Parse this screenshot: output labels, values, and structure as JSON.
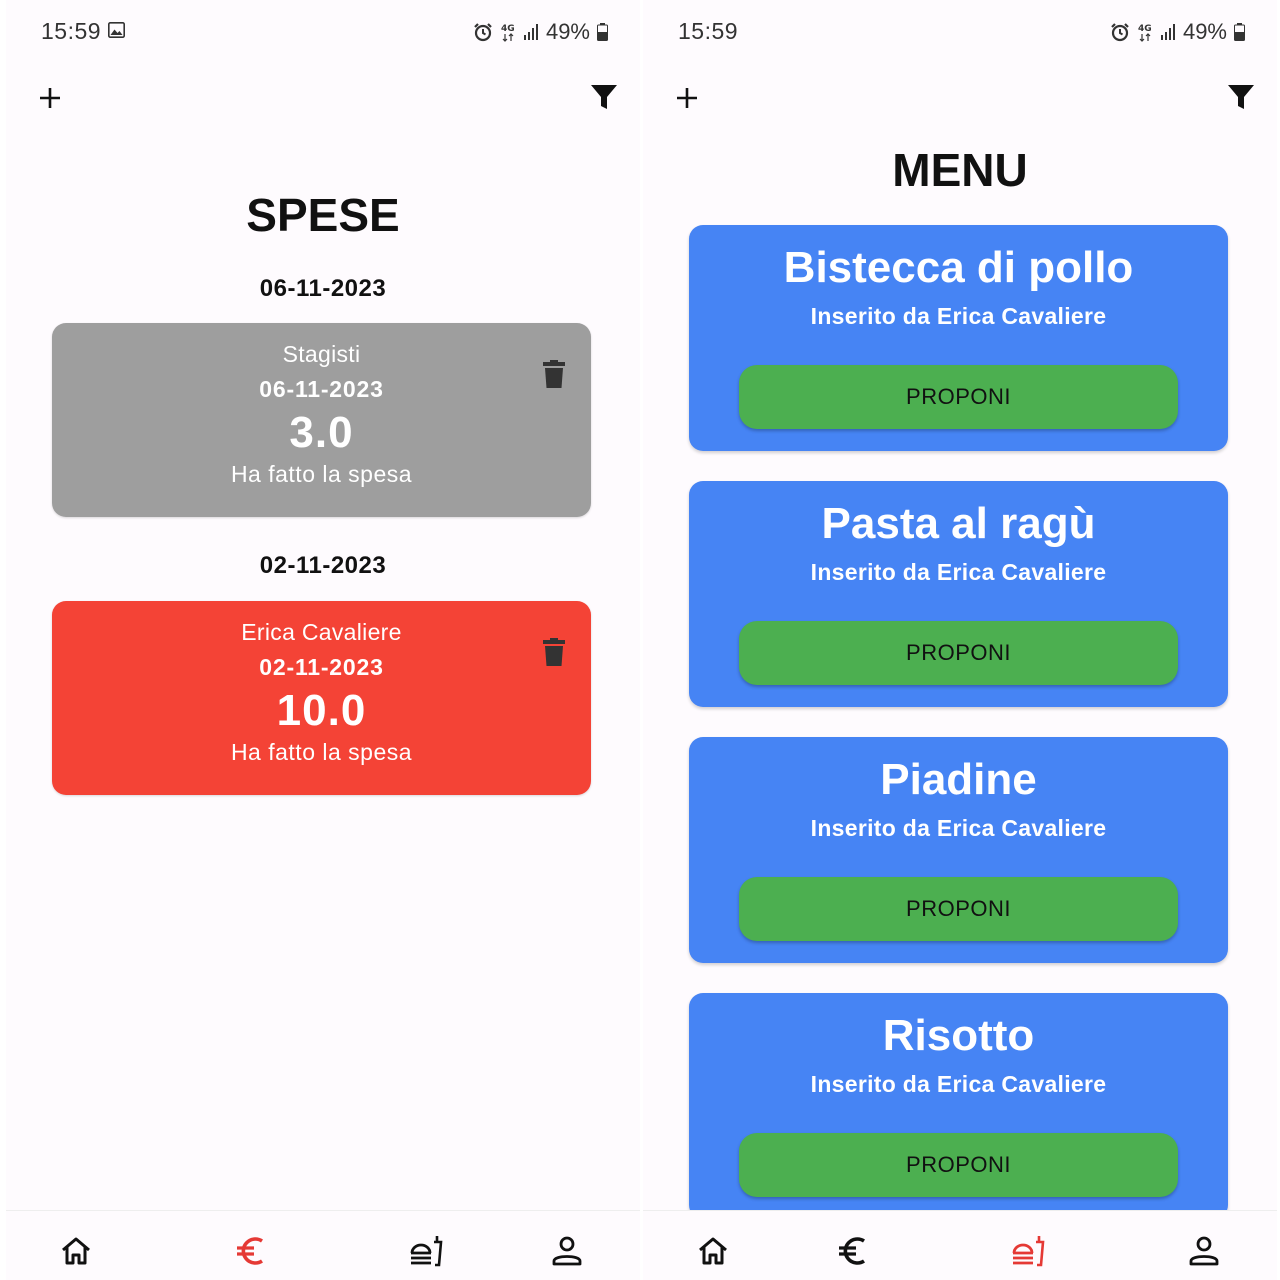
{
  "status_bar": {
    "time": "15:59",
    "battery": "49%",
    "network": "4G",
    "icons": [
      "image-icon",
      "alarm-icon",
      "signal-icon",
      "battery-icon"
    ]
  },
  "left_screen": {
    "title": "SPESE",
    "groups": [
      {
        "date": "06-11-2023",
        "card": {
          "name": "Stagisti",
          "date": "06-11-2023",
          "amount": "3.0",
          "description": "Ha fatto la spesa",
          "color": "#9e9e9e"
        }
      },
      {
        "date": "02-11-2023",
        "card": {
          "name": "Erica Cavaliere",
          "date": "02-11-2023",
          "amount": "10.0",
          "description": "Ha fatto la spesa",
          "color": "#f44336"
        }
      }
    ],
    "active_nav": "euro"
  },
  "right_screen": {
    "title": "MENU",
    "items": [
      {
        "title": "Bistecca di pollo",
        "subtitle": "Inserito da Erica Cavaliere",
        "button": "PROPONI"
      },
      {
        "title": "Pasta al ragù",
        "subtitle": "Inserito da Erica Cavaliere",
        "button": "PROPONI"
      },
      {
        "title": "Piadine",
        "subtitle": "Inserito da Erica Cavaliere",
        "button": "PROPONI"
      },
      {
        "title": "Risotto",
        "subtitle": "Inserito da Erica Cavaliere",
        "button": "PROPONI"
      }
    ],
    "active_nav": "menu"
  },
  "nav": {
    "items": [
      "home-icon",
      "euro-icon",
      "food-menu-icon",
      "profile-icon"
    ],
    "active_color": "#e53935",
    "inactive_color": "#111111"
  },
  "colors": {
    "menu_card": "#4684f4",
    "propose_button": "#4caf50"
  }
}
